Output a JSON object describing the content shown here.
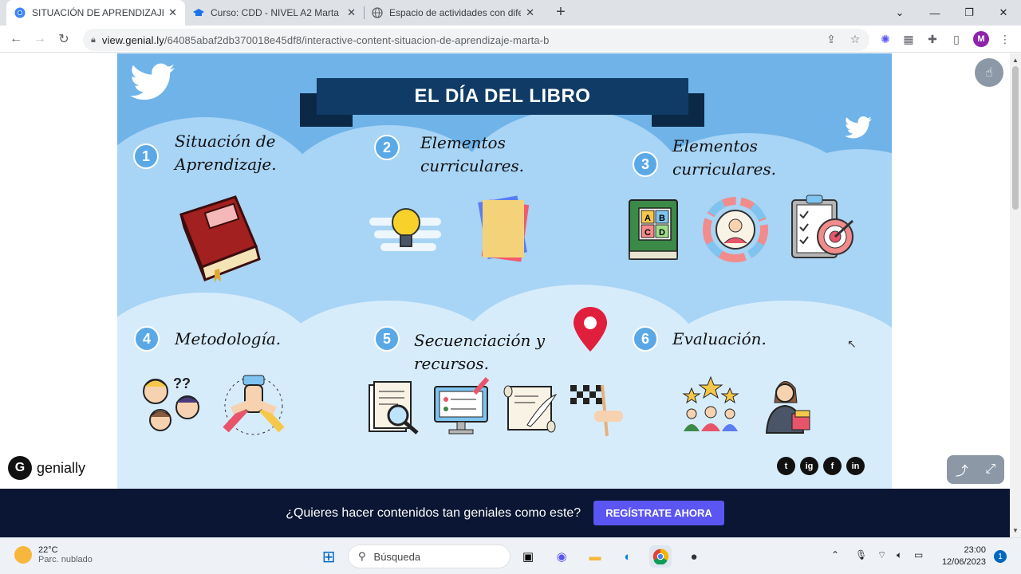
{
  "browser": {
    "tabs": [
      {
        "title": "SITUACIÓN DE APRENDIZAJE - M",
        "active": true,
        "icon": "chrome-icon"
      },
      {
        "title": "Curso: CDD - NIVEL A2 Marta Bo",
        "active": false,
        "icon": "graduation-cap-icon"
      },
      {
        "title": "Espacio de actividades con difere",
        "active": false,
        "icon": "globe-icon"
      }
    ],
    "url_host": "view.genial.ly",
    "url_path": "/64085abaf2db370018e45df8/interactive-content-situacion-de-aprendizaje-marta-b",
    "avatar_letter": "M"
  },
  "slide": {
    "title": "EL DÍA DEL LIBRO",
    "sections": [
      {
        "number": "1",
        "label": "Situación de Aprendizaje."
      },
      {
        "number": "2",
        "label": "Elementos curriculares."
      },
      {
        "number": "3",
        "label": "Elementos curriculares."
      },
      {
        "number": "4",
        "label": "Metodología."
      },
      {
        "number": "5",
        "label": "Secuenciación y recursos."
      },
      {
        "number": "6",
        "label": "Evaluación."
      }
    ],
    "abc_labels": [
      "A",
      "B",
      "C",
      "D"
    ],
    "social": [
      "t",
      "ig",
      "f",
      "in"
    ]
  },
  "genially": {
    "logo_text": "genially"
  },
  "promo": {
    "text": "¿Quieres hacer contenidos tan geniales como este?",
    "cta": "REGÍSTRATE AHORA"
  },
  "taskbar": {
    "weather_temp": "22°C",
    "weather_desc": "Parc. nublado",
    "search_placeholder": "Búsqueda",
    "time": "23:00",
    "date": "12/06/2023",
    "notifications": "1"
  },
  "colors": {
    "slide_bg": "#6fb3e8",
    "banner": "#0f3b66",
    "cta": "#5b55f2",
    "promo_bg": "#0a1633"
  }
}
